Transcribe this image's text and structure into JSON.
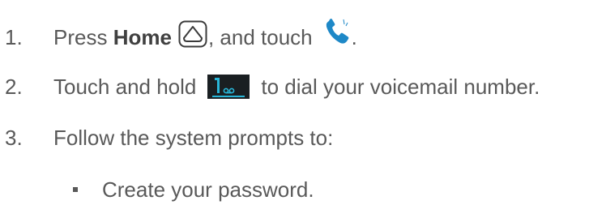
{
  "steps": [
    {
      "number": "1.",
      "text_before": "Press",
      "bold": "Home",
      "text_middle": ", and touch",
      "text_after": ".",
      "icons": [
        "home-icon",
        "phone-icon"
      ]
    },
    {
      "number": "2.",
      "text_before": "Touch and hold",
      "text_after": "to dial your voicemail number.",
      "icons": [
        "voicemail-key-icon"
      ]
    },
    {
      "number": "3.",
      "text": "Follow the system prompts to:"
    }
  ],
  "bullets": [
    {
      "text": "Create your password."
    }
  ],
  "colors": {
    "text": "#595959",
    "phone": "#1e88c7",
    "voicemail_key_bg": "#1a1f22",
    "voicemail_key_accent": "#29b6d8"
  }
}
